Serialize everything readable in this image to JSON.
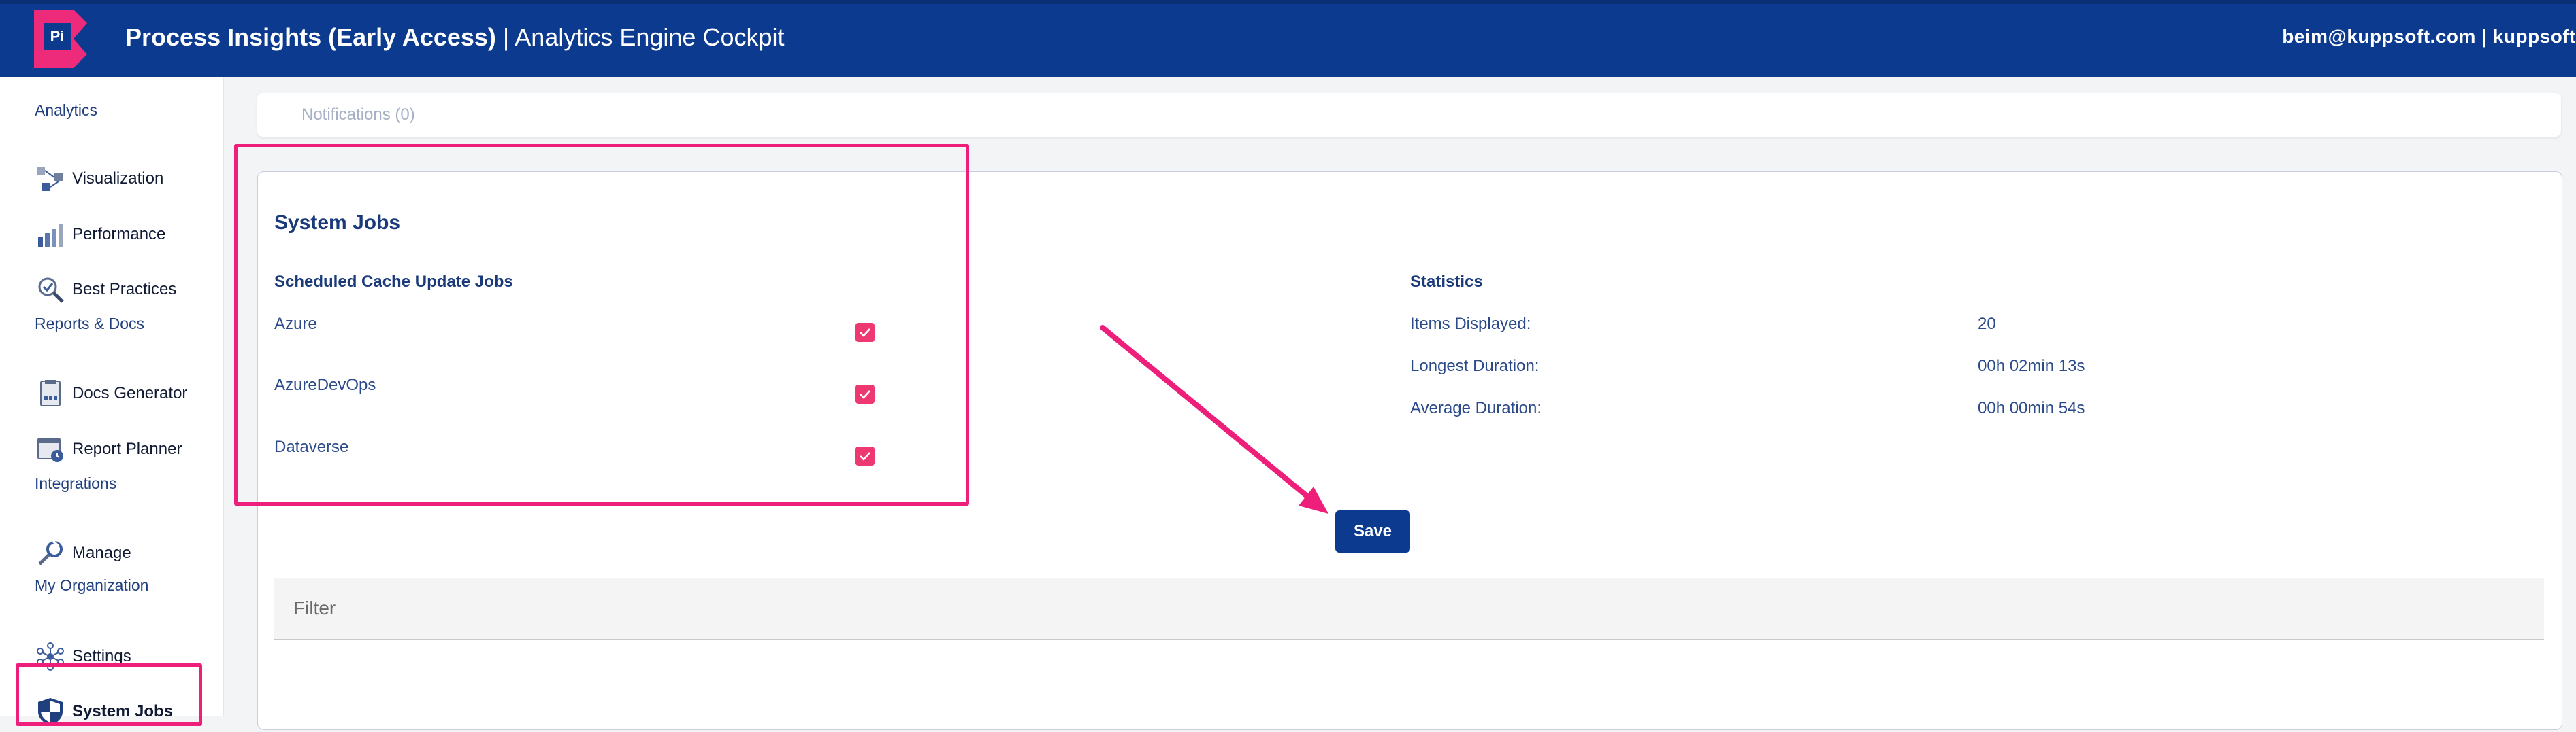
{
  "header": {
    "logo_text": "Pi",
    "title_bold": "Process Insights (Early Access)",
    "title_sep": " | ",
    "title_rest": "Analytics Engine Cockpit",
    "user": "beim@kuppsoft.com | kuppsoft"
  },
  "sidebar": {
    "sections": [
      {
        "label": "Analytics",
        "items": [
          {
            "label": "Visualization",
            "icon": "visualization-icon"
          },
          {
            "label": "Performance",
            "icon": "performance-icon"
          },
          {
            "label": "Best Practices",
            "icon": "best-practices-icon"
          }
        ]
      },
      {
        "label": "Reports & Docs",
        "items": [
          {
            "label": "Docs Generator",
            "icon": "docs-generator-icon"
          },
          {
            "label": "Report Planner",
            "icon": "report-planner-icon"
          }
        ]
      },
      {
        "label": "Integrations",
        "items": [
          {
            "label": "Manage",
            "icon": "manage-icon"
          }
        ]
      },
      {
        "label": "My Organization",
        "items": [
          {
            "label": "Settings",
            "icon": "settings-icon"
          },
          {
            "label": "System Jobs",
            "icon": "system-jobs-icon"
          }
        ]
      }
    ]
  },
  "notifications": {
    "label": "Notifications (0)"
  },
  "main": {
    "title": "System Jobs",
    "jobs_heading": "Scheduled Cache Update Jobs",
    "jobs": [
      {
        "label": "Azure",
        "checked": true
      },
      {
        "label": "AzureDevOps",
        "checked": true
      },
      {
        "label": "Dataverse",
        "checked": true
      }
    ],
    "statistics": {
      "title": "Statistics",
      "rows": [
        {
          "key": "Items Displayed:",
          "value": "20"
        },
        {
          "key": "Longest Duration:",
          "value": "00h 02min 13s"
        },
        {
          "key": "Average Duration:",
          "value": "00h 00min 54s"
        }
      ]
    },
    "save_label": "Save",
    "filter_placeholder": "Filter"
  },
  "colors": {
    "header_bg": "#0b3a8f",
    "accent_pink": "#ee1f7a",
    "checkbox": "#ee3872",
    "text_navy": "#1a3a7a"
  }
}
